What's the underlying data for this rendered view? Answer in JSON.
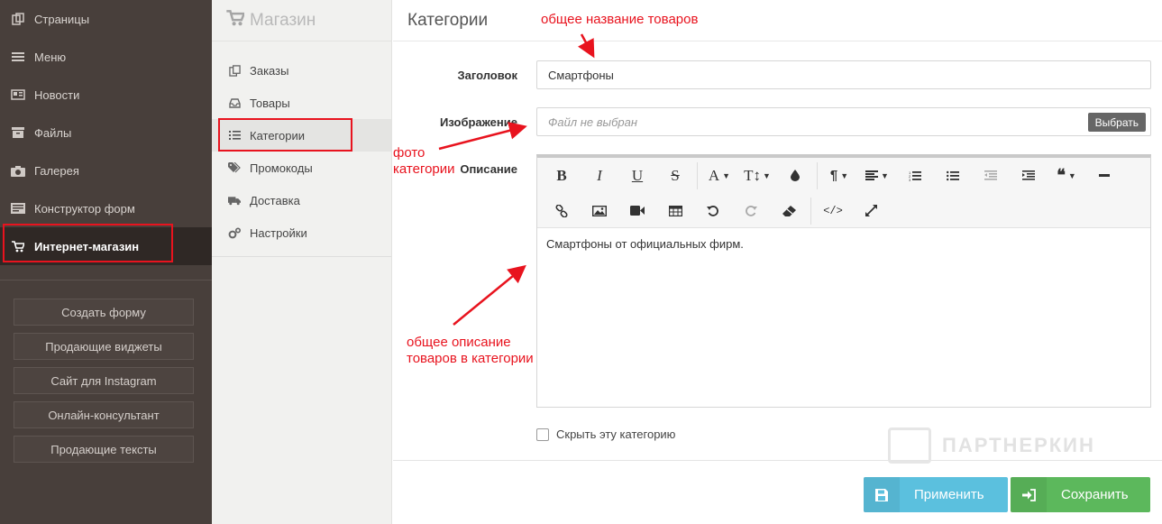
{
  "sidebar": {
    "items": [
      {
        "label": "Страницы",
        "icon": "pages-icon"
      },
      {
        "label": "Меню",
        "icon": "menu-icon"
      },
      {
        "label": "Новости",
        "icon": "news-icon"
      },
      {
        "label": "Файлы",
        "icon": "files-icon"
      },
      {
        "label": "Галерея",
        "icon": "camera-icon"
      },
      {
        "label": "Конструктор форм",
        "icon": "form-builder-icon"
      },
      {
        "label": "Интернет-магазин",
        "icon": "cart-icon"
      }
    ],
    "buttons": [
      "Создать форму",
      "Продающие виджеты",
      "Сайт для Instagram",
      "Онлайн-консультант",
      "Продающие тексты"
    ]
  },
  "shop_nav": {
    "title": "Магазин",
    "items": [
      {
        "label": "Заказы",
        "icon": "copy-icon"
      },
      {
        "label": "Товары",
        "icon": "inbox-icon"
      },
      {
        "label": "Категории",
        "icon": "list-icon"
      },
      {
        "label": "Промокоды",
        "icon": "tags-icon"
      },
      {
        "label": "Доставка",
        "icon": "truck-icon"
      },
      {
        "label": "Настройки",
        "icon": "cogs-icon"
      }
    ]
  },
  "main": {
    "title": "Категории",
    "title_label": "Заголовок",
    "title_value": "Смартфоны",
    "image_label": "Изображение",
    "image_placeholder": "Файл не выбран",
    "image_button": "Выбрать",
    "description_label": "Описание",
    "description_value": "Смартфоны от официальных фирм.",
    "hide_checkbox_label": "Скрыть эту категорию",
    "hide_checked": false,
    "apply_button": "Применить",
    "save_button": "Сохранить"
  },
  "annotations": {
    "title_note": "общее название товаров",
    "photo_note_line1": "фото",
    "photo_note_line2": "категории",
    "desc_note_line1": "общее описание",
    "desc_note_line2": "товаров в категории"
  },
  "watermark": "ПАРТНЕРКИН",
  "colors": {
    "sidebar_bg": "#483f3b",
    "apply": "#5bc0de",
    "save": "#5cb85c",
    "annotation": "#e8131e"
  }
}
